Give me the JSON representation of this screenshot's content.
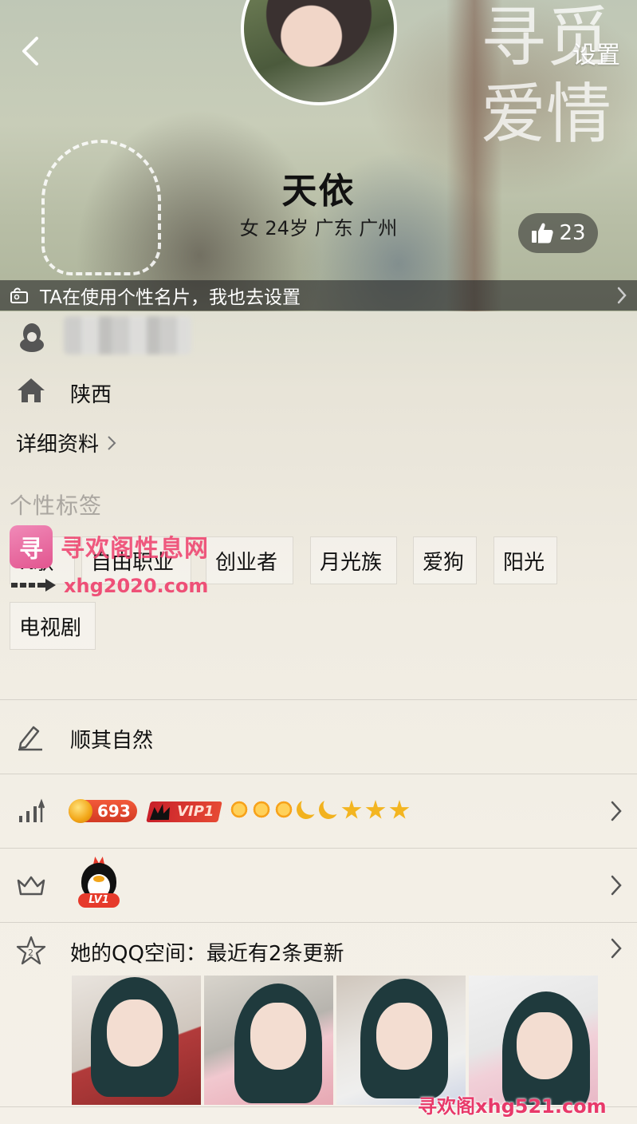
{
  "nav": {
    "settings_label": "设置"
  },
  "profile": {
    "name": "天依",
    "sub_info": "女 24岁 广东 广州",
    "like_count": "23",
    "banner_text": "TA在使用个性名片，我也去设置",
    "header_deco_text": "寻觅爱情"
  },
  "info": {
    "hometown": "陕西",
    "detail_link": "详细资料"
  },
  "tags": {
    "title": "个性标签",
    "items": [
      "K歌",
      "自由职业",
      "创业者",
      "月光族",
      "爱狗",
      "阳光",
      "电视剧"
    ]
  },
  "motto": "顺其自然",
  "level": {
    "coin_value": "693",
    "vip_label": "VIP1",
    "level_icons": [
      "sun",
      "sun",
      "sun",
      "moon",
      "moon",
      "star",
      "star",
      "star"
    ]
  },
  "qq_level": {
    "badge_label": "LV1"
  },
  "qzone": {
    "title": "她的QQ空间：最近有2条更新",
    "photo_count": 4
  },
  "watermarks": {
    "logo_text": "寻",
    "site_name": "寻欢阁性息网",
    "site_url": "xhg2020.com",
    "bottom_text": "寻欢阁xhg521.com"
  },
  "colors": {
    "accent_pink": "#e8396a",
    "vip_red": "#c8202a",
    "coin_gold": "#f2a516"
  }
}
